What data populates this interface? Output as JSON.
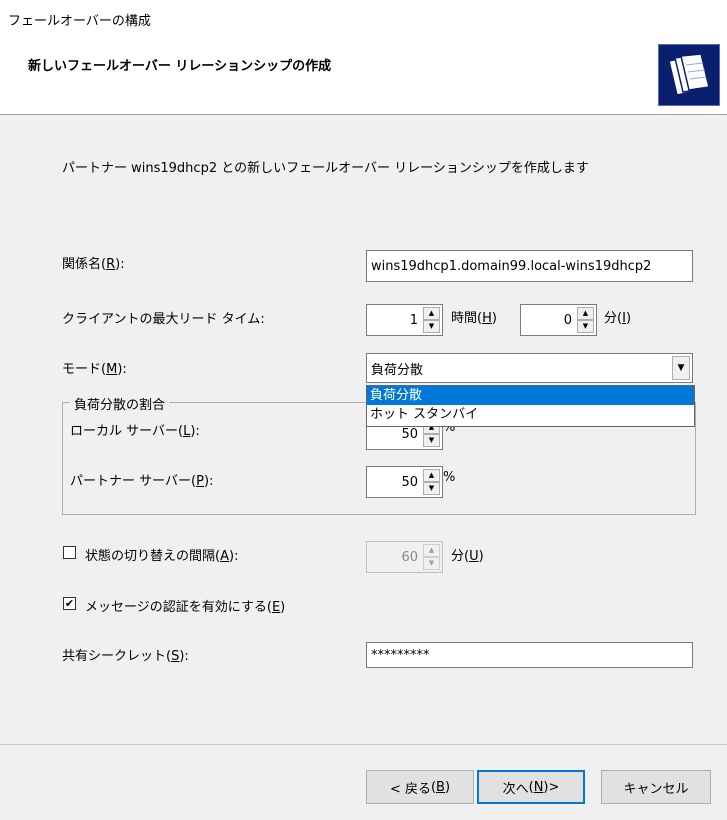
{
  "window": {
    "title": "フェールオーバーの構成"
  },
  "header": {
    "title": "新しいフェールオーバー リレーションシップの作成",
    "icon": "wizard-folders-icon"
  },
  "description": "パートナー wins19dhcp2 との新しいフェールオーバー リレーションシップを作成します",
  "relationship_name": {
    "label": "関係名",
    "accel": "R",
    "value": "wins19dhcp1.domain99.local-wins19dhcp2"
  },
  "mclt": {
    "label": "クライアントの最大リード タイム:",
    "hours_value": "1",
    "hours_label": "時間",
    "hours_accel": "H",
    "minutes_value": "0",
    "minutes_label": "分",
    "minutes_accel": "I"
  },
  "mode": {
    "label": "モード",
    "accel": "M",
    "selected": "負荷分散",
    "options": [
      "負荷分散",
      "ホット スタンバイ"
    ]
  },
  "load_balance": {
    "group_title": "負荷分散の割合",
    "local_label": "ローカル サーバー",
    "local_accel": "L",
    "local_value": "50",
    "partner_label": "パートナー サーバー",
    "partner_accel": "P",
    "partner_value": "50",
    "unit": "%"
  },
  "state_switch": {
    "label": "状態の切り替えの間隔",
    "accel": "A",
    "checked": false,
    "value": "60",
    "unit": "分",
    "unit_accel": "U"
  },
  "message_auth": {
    "label": "メッセージの認証を有効にする",
    "accel": "E",
    "checked": true
  },
  "shared_secret": {
    "label": "共有シークレット",
    "accel": "S",
    "value": "*********"
  },
  "buttons": {
    "back": {
      "label": "< 戻る",
      "accel": "B"
    },
    "next": {
      "label": "次へ",
      "accel": "N",
      "suffix": " >"
    },
    "cancel": "キャンセル"
  }
}
